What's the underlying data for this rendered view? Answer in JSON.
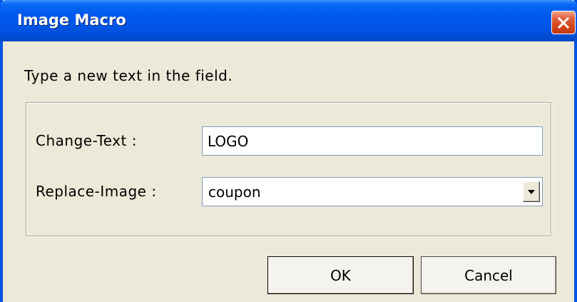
{
  "window": {
    "title": "Image Macro",
    "close_icon": "close-x-icon"
  },
  "instruction": "Type a new text in the field.",
  "form": {
    "change_text_label": "Change-Text :",
    "change_text_value": "LOGO",
    "replace_image_label": "Replace-Image :",
    "replace_image_value": "coupon",
    "dropdown_icon": "chevron-down-icon"
  },
  "buttons": {
    "ok_label": "OK",
    "cancel_label": "Cancel"
  },
  "colors": {
    "titlebar": "#0054e3",
    "dialog_background": "#ece9d8",
    "close_button": "#d04417",
    "input_border": "#7f9db9"
  }
}
